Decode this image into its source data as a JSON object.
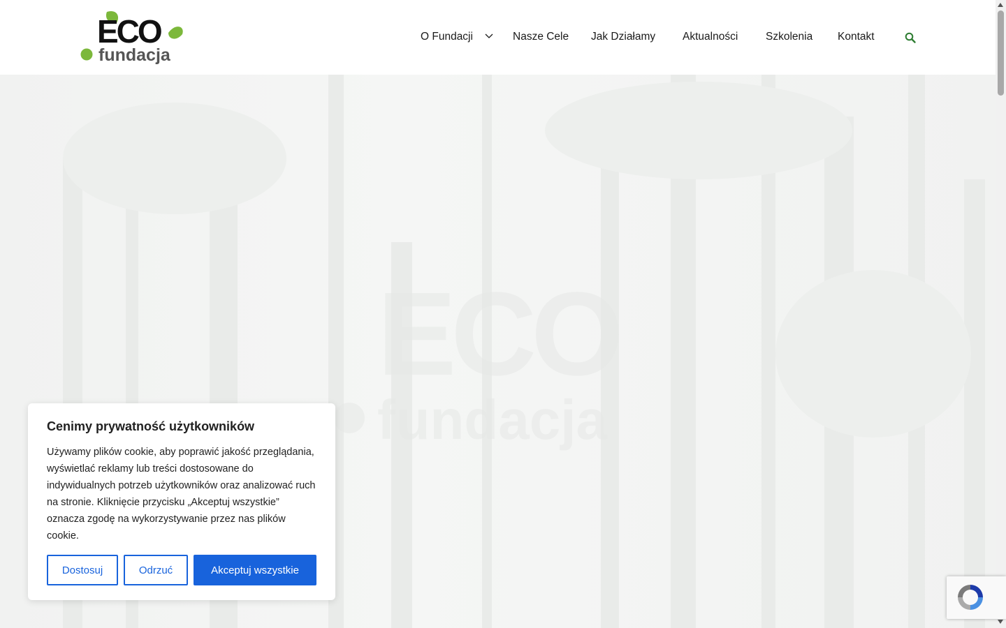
{
  "brand": {
    "logo_top": "ECO",
    "logo_bottom": "fundacja",
    "colors": {
      "green": "#7cb83b",
      "dark": "#1a1a1a",
      "gray": "#555555",
      "accent_blue": "#1863dc"
    }
  },
  "nav": {
    "items": [
      {
        "label": "O Fundacji",
        "has_dropdown": true
      },
      {
        "label": "Nasze Cele"
      },
      {
        "label": "Jak Działamy"
      },
      {
        "label": "Aktualności"
      },
      {
        "label": "Szkolenia"
      },
      {
        "label": "Kontakt"
      }
    ],
    "search_icon": "search-icon"
  },
  "hero": {
    "watermark_top": "ECO",
    "watermark_bottom": "fundacja"
  },
  "cookie": {
    "title": "Cenimy prywatność użytkowników",
    "text": "Używamy plików cookie, aby poprawić jakość przeglądania, wyświetlać reklamy lub treści dostosowane do indywidualnych potrzeb użytkowników oraz analizować ruch na stronie. Kliknięcie przycisku „Akceptuj wszystkie” oznacza zgodę na wykorzystywanie przez nas plików cookie.",
    "customize_label": "Dostosuj",
    "reject_label": "Odrzuć",
    "accept_label": "Akceptuj wszystkie"
  },
  "recaptcha": {
    "icon": "recaptcha-icon"
  }
}
